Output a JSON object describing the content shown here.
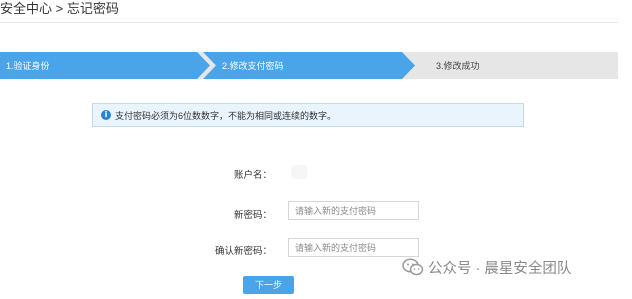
{
  "breadcrumb": "安全中心 > 忘记密码",
  "steps": [
    {
      "label": "1.验证身份",
      "state": "done"
    },
    {
      "label": "2.修改支付密码",
      "state": "active"
    },
    {
      "label": "3.修改成功",
      "state": "pending"
    }
  ],
  "notice": {
    "icon": "info-icon",
    "text": "支付密码必须为6位数数字，不能为相同或连续的数字。"
  },
  "form": {
    "account_label": "账户名：",
    "account_value": "",
    "new_password_label": "新密码：",
    "new_password_placeholder": "请输入新的支付密码",
    "confirm_password_label": "确认新密码：",
    "confirm_password_placeholder": "请输入新的支付密码",
    "next_button": "下一步"
  },
  "watermark": {
    "icon": "wechat-icon",
    "text": "公众号 · 晨星安全团队"
  },
  "colors": {
    "accent": "#4aa4ea",
    "step_pending": "#e6e6e6",
    "notice_bg": "#e9f4fd",
    "notice_border": "#bcdcf5",
    "info_icon": "#2a83d4"
  }
}
